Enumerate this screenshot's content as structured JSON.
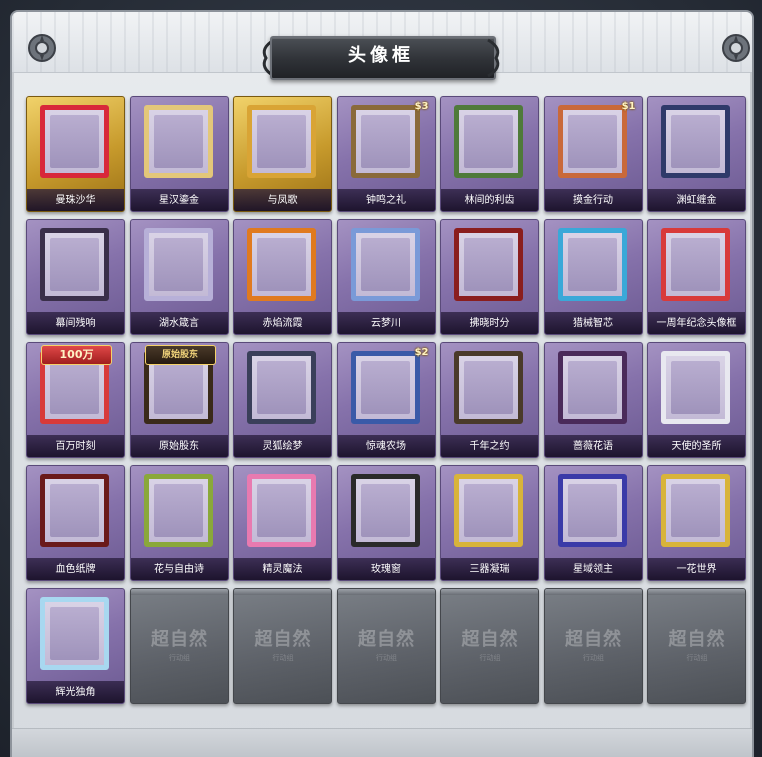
{
  "title": "头像框",
  "locked_emblem_text": "超自然",
  "locked_emblem_sub": "行动组",
  "frames": [
    {
      "label": "曼珠沙华",
      "style": "gold",
      "accent": "#d8283a"
    },
    {
      "label": "星汉鎏金",
      "style": "owned",
      "accent": "#e3c77a"
    },
    {
      "label": "与凤歌",
      "style": "gold",
      "accent": "#d9a435"
    },
    {
      "label": "钟鸣之礼",
      "style": "owned",
      "accent": "#8a6a3a",
      "badge": "$3"
    },
    {
      "label": "林间的利齿",
      "style": "owned",
      "accent": "#4f7a3a"
    },
    {
      "label": "摸金行动",
      "style": "owned",
      "accent": "#c9693a",
      "badge": "$1"
    },
    {
      "label": "渊虹缠金",
      "style": "owned",
      "accent": "#2f3a6a"
    },
    {
      "label": "幕间残响",
      "style": "owned",
      "accent": "#3a2f4a"
    },
    {
      "label": "湖水箴言",
      "style": "owned",
      "accent": "#b7b0d8"
    },
    {
      "label": "赤焰流霞",
      "style": "owned",
      "accent": "#e07a1f"
    },
    {
      "label": "云梦川",
      "style": "owned",
      "accent": "#7a9ad8"
    },
    {
      "label": "拂晓时分",
      "style": "owned",
      "accent": "#8a1e1e"
    },
    {
      "label": "猎械智芯",
      "style": "owned",
      "accent": "#3aa8d8"
    },
    {
      "label": "一周年纪念头像框",
      "style": "owned",
      "accent": "#d83a3a"
    },
    {
      "label": "百万时刻",
      "style": "owned",
      "accent": "#d83a3a",
      "banner": "100万"
    },
    {
      "label": "原始股东",
      "style": "owned",
      "accent": "#3a2a1a",
      "banner": "原始股东",
      "banner_dark": true
    },
    {
      "label": "灵狐绘梦",
      "style": "owned",
      "accent": "#3a3f5a"
    },
    {
      "label": "惊魂农场",
      "style": "owned",
      "accent": "#3a5aa8",
      "badge": "$2"
    },
    {
      "label": "千年之约",
      "style": "owned",
      "accent": "#4a3a2a"
    },
    {
      "label": "蔷薇花语",
      "style": "owned",
      "accent": "#4a2a5a"
    },
    {
      "label": "天使的圣所",
      "style": "owned",
      "accent": "#e8e8f0"
    },
    {
      "label": "血色纸牌",
      "style": "owned",
      "accent": "#6a1a1a"
    },
    {
      "label": "花与自由诗",
      "style": "owned",
      "accent": "#8aa83a"
    },
    {
      "label": "精灵魔法",
      "style": "owned",
      "accent": "#e87ab0"
    },
    {
      "label": "玫瑰窗",
      "style": "owned",
      "accent": "#2a2a2a"
    },
    {
      "label": "三器凝瑞",
      "style": "owned",
      "accent": "#d8b43a"
    },
    {
      "label": "星域领主",
      "style": "owned",
      "accent": "#3a3aa8"
    },
    {
      "label": "一花世界",
      "style": "owned",
      "accent": "#d8b43a"
    },
    {
      "label": "辉光独角",
      "style": "owned",
      "accent": "#a8d8f0"
    },
    {
      "label": "",
      "style": "locked"
    },
    {
      "label": "",
      "style": "locked"
    },
    {
      "label": "",
      "style": "locked"
    },
    {
      "label": "",
      "style": "locked"
    },
    {
      "label": "",
      "style": "locked"
    },
    {
      "label": "",
      "style": "locked"
    }
  ]
}
